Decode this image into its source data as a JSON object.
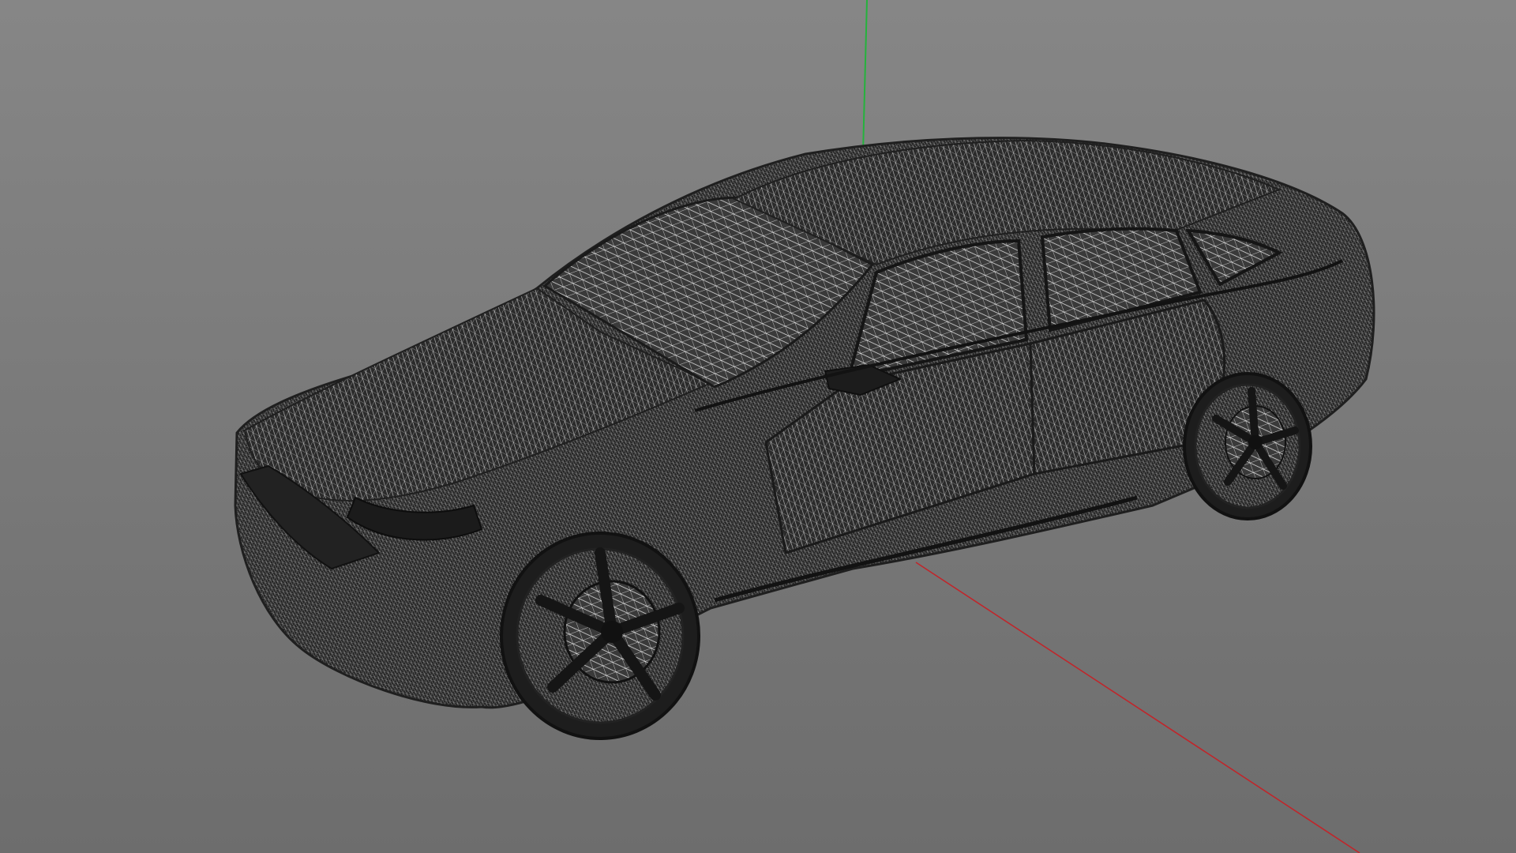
{
  "viewport": {
    "background_top": "#868686",
    "background_bottom": "#6d6d6d",
    "display_mode": "wireframe"
  },
  "axes": {
    "x_color": "#c0262b",
    "y_color": "#24b33c"
  },
  "model": {
    "type": "car",
    "mesh_color": "#2b2b2b",
    "wire_color": "#e6e6e6"
  }
}
